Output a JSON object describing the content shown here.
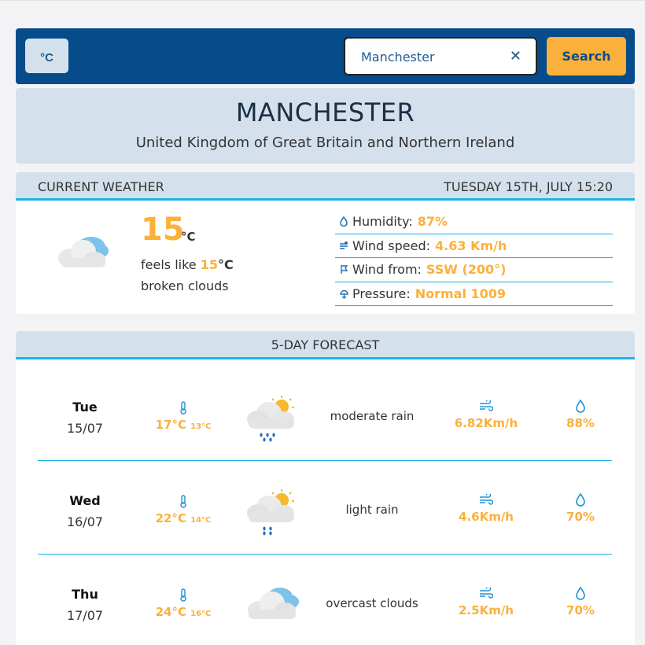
{
  "header": {
    "unit_toggle": "°C",
    "search_value": "Manchester",
    "clear_icon": "✕",
    "search_label": "Search"
  },
  "city": {
    "name": "MANCHESTER",
    "country": "United Kingdom of Great Britain and Northern Ireland"
  },
  "current": {
    "section_title": "CURRENT WEATHER",
    "datetime": "TUESDAY 15TH, JULY 15:20",
    "icon": "broken-clouds-icon",
    "temperature": "15",
    "temperature_unit": "°C",
    "feels_like_prefix": "feels like ",
    "feels_like_value": "15",
    "feels_like_unit": "°C",
    "description": "broken clouds",
    "details": [
      {
        "icon": "humidity-icon",
        "label": "Humidity:",
        "value": "87%"
      },
      {
        "icon": "wind-speed-icon",
        "label": "Wind speed:",
        "value": "4.63 Km/h"
      },
      {
        "icon": "wind-direction-icon",
        "label": "Wind from:",
        "value": "SSW (200°)"
      },
      {
        "icon": "pressure-icon",
        "label": "Pressure:",
        "value": "Normal 1009"
      }
    ]
  },
  "forecast": {
    "title": "5-DAY FORECAST",
    "days": [
      {
        "day": "Tue",
        "date": "15/07",
        "high": "17°C",
        "low": "13°C",
        "icon": "rain-sun-cloud-icon",
        "description": "moderate rain",
        "wind": "6.82Km/h",
        "humidity": "88%"
      },
      {
        "day": "Wed",
        "date": "16/07",
        "high": "22°C",
        "low": "14°C",
        "icon": "rain-sun-cloud-icon",
        "description": "light rain",
        "wind": "4.6Km/h",
        "humidity": "70%"
      },
      {
        "day": "Thu",
        "date": "17/07",
        "high": "24°C",
        "low": "16°C",
        "icon": "overcast-clouds-icon",
        "description": "overcast clouds",
        "wind": "2.5Km/h",
        "humidity": "70%"
      }
    ]
  },
  "colors": {
    "header_bg": "#064b8a",
    "card_bg": "#d4e1ec",
    "accent_orange": "#fbb03b",
    "accent_cyan": "#19b3e6"
  }
}
